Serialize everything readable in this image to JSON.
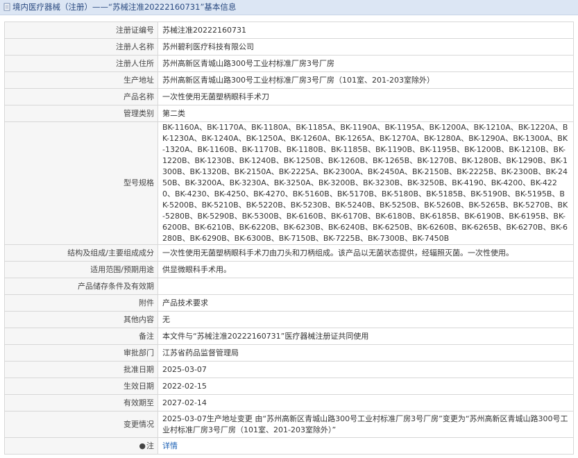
{
  "header": {
    "title": "境内医疗器械（注册）——“苏械注准20222160731”基本信息"
  },
  "rows": [
    {
      "label": "注册证编号",
      "value": "苏械注准20222160731"
    },
    {
      "label": "注册人名称",
      "value": "苏州碧利医疗科技有限公司"
    },
    {
      "label": "注册人住所",
      "value": "苏州高新区青城山路300号工业村标准厂房3号厂房"
    },
    {
      "label": "生产地址",
      "value": "苏州高新区青城山路300号工业村标准厂房3号厂房（101室、201-203室除外）"
    },
    {
      "label": "产品名称",
      "value": "一次性使用无菌塑柄眼科手术刀"
    },
    {
      "label": "管理类别",
      "value": "第二类"
    },
    {
      "label": "型号规格",
      "value": "BK-1160A、BK-1170A、BK-1180A、BK-1185A、BK-1190A、BK-1195A、BK-1200A、BK-1210A、BK-1220A、BK-1230A、BK-1240A、BK-1250A、BK-1260A、BK-1265A、BK-1270A、BK-1280A、BK-1290A、BK-1300A、BK-1320A、BK-1160B、BK-1170B、BK-1180B、BK-1185B、BK-1190B、BK-1195B、BK-1200B、BK-1210B、BK-1220B、BK-1230B、BK-1240B、BK-1250B、BK-1260B、BK-1265B、BK-1270B、BK-1280B、BK-1290B、BK-1300B、BK-1320B、BK-2150A、BK-2225A、BK-2300A、BK-2450A、BK-2150B、BK-2225B、BK-2300B、BK-2450B、BK-3200A、BK-3230A、BK-3250A、BK-3200B、BK-3230B、BK-3250B、BK-4190、BK-4200、BK-4220、BK-4230、BK-4250、BK-4270、BK-5160B、BK-5170B、BK-5180B、BK-5185B、BK-5190B、BK-5195B、BK-5200B、BK-5210B、BK-5220B、BK-5230B、BK-5240B、BK-5250B、BK-5260B、BK-5265B、BK-5270B、BK-5280B、BK-5290B、BK-5300B、BK-6160B、BK-6170B、BK-6180B、BK-6185B、BK-6190B、BK-6195B、BK-6200B、BK-6210B、BK-6220B、BK-6230B、BK-6240B、BK-6250B、BK-6260B、BK-6265B、BK-6270B、BK-6280B、BK-6290B、BK-6300B、BK-7150B、BK-7225B、BK-7300B、BK-7450B"
    },
    {
      "label": "结构及组成/主要组成成分",
      "value": "一次性使用无菌塑柄眼科手术刀由刀头和刀柄组成。该产品以无菌状态提供，经辐照灭菌。一次性使用。"
    },
    {
      "label": "适用范围/预期用途",
      "value": "供显微眼科手术用。"
    },
    {
      "label": "产品储存条件及有效期",
      "value": ""
    },
    {
      "label": "附件",
      "value": "产品技术要求"
    },
    {
      "label": "其他内容",
      "value": "无"
    },
    {
      "label": "备注",
      "value": "本文件与“苏械注准20222160731”医疗器械注册证共同使用"
    },
    {
      "label": "审批部门",
      "value": "江苏省药品监督管理局"
    },
    {
      "label": "批准日期",
      "value": "2025-03-07"
    },
    {
      "label": "生效日期",
      "value": "2022-02-15"
    },
    {
      "label": "有效期至",
      "value": "2027-02-14"
    },
    {
      "label": "变更情况",
      "value": "2025-03-07生产地址变更 由“苏州高新区青城山路300号工业村标准厂房3号厂房”变更为“苏州高新区青城山路300号工业村标准厂房3号厂房（101室、201-203室除外）”"
    }
  ],
  "footer": {
    "icon": "pin-icon",
    "label": "注",
    "link": "详情"
  }
}
